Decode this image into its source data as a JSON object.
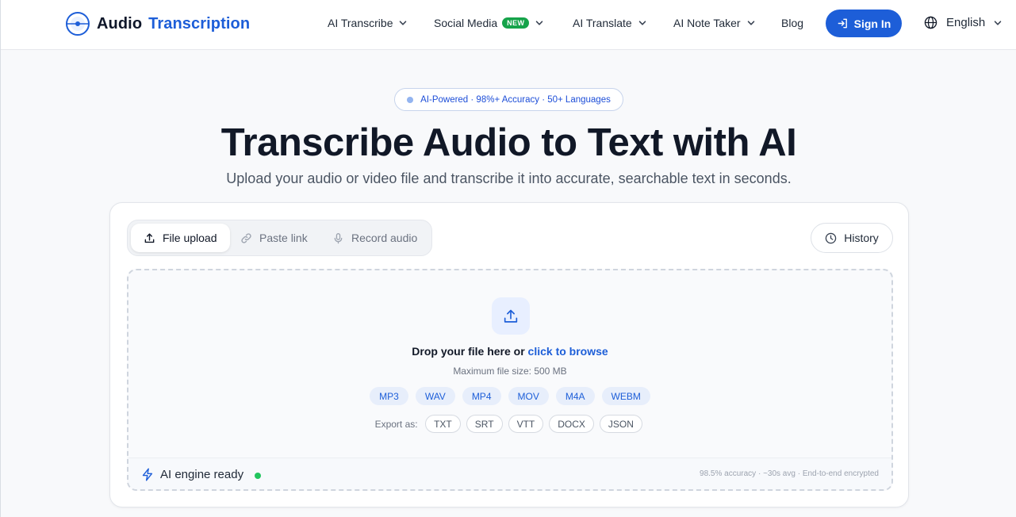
{
  "header": {
    "brand": {
      "word1": "Audio",
      "word2": "Transcription"
    },
    "nav": [
      {
        "label": "AI Transcribe",
        "has_dropdown": true
      },
      {
        "label": "Social Media",
        "badge": "NEW",
        "has_dropdown": true
      },
      {
        "label": "AI Translate",
        "has_dropdown": true
      },
      {
        "label": "AI Note Taker",
        "has_dropdown": true
      },
      {
        "label": "Blog",
        "has_dropdown": false
      }
    ],
    "signin_label": "Sign In",
    "language": "English"
  },
  "hero": {
    "pill": "AI-Powered · 98%+ Accuracy · 50+ Languages",
    "title": "Transcribe Audio to Text with AI",
    "subtitle": "Upload your audio or video file and transcribe it into accurate, searchable text in seconds."
  },
  "tabs": [
    {
      "label": "File upload",
      "icon": "upload-icon",
      "active": true
    },
    {
      "label": "Paste link",
      "icon": "link-icon",
      "active": false
    },
    {
      "label": "Record audio",
      "icon": "microphone-icon",
      "active": false
    }
  ],
  "history_label": "History",
  "dropzone": {
    "prompt": "Drop your file here or",
    "browse": "click to browse",
    "max_size": "Maximum file size: 500 MB",
    "formats": [
      "MP3",
      "WAV",
      "MP4",
      "MOV",
      "M4A",
      "WEBM"
    ],
    "export_label": "Export as:",
    "exports": [
      "TXT",
      "SRT",
      "VTT",
      "DOCX",
      "JSON"
    ]
  },
  "status": {
    "engine": "AI engine ready",
    "stats": "98.5% accuracy · ~30s avg · End-to-end encrypted"
  },
  "colors": {
    "accent": "#1d5ed8",
    "ready": "#22c55e",
    "badge_new": "#16a34a"
  }
}
